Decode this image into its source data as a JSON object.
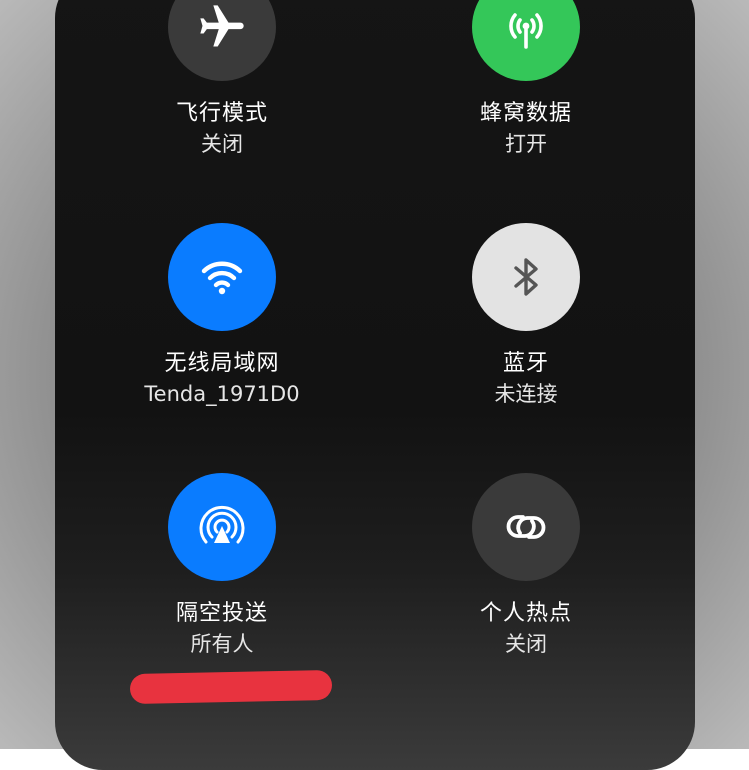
{
  "tiles": {
    "airplane": {
      "label": "飞行模式",
      "status": "关闭",
      "color": "#3a3a3a",
      "icon": "airplane-icon"
    },
    "cellular": {
      "label": "蜂窝数据",
      "status": "打开",
      "color": "#34c759",
      "icon": "antenna-icon"
    },
    "wifi": {
      "label": "无线局域网",
      "status": "Tenda_1971D0",
      "color": "#0a7cff",
      "icon": "wifi-icon"
    },
    "bluetooth": {
      "label": "蓝牙",
      "status": "未连接",
      "color": "#e3e3e3",
      "icon": "bluetooth-icon"
    },
    "airdrop": {
      "label": "隔空投送",
      "status": "所有人",
      "color": "#0a7cff",
      "icon": "airdrop-icon"
    },
    "hotspot": {
      "label": "个人热点",
      "status": "关闭",
      "color": "#3a3a3a",
      "icon": "link-icon"
    }
  }
}
